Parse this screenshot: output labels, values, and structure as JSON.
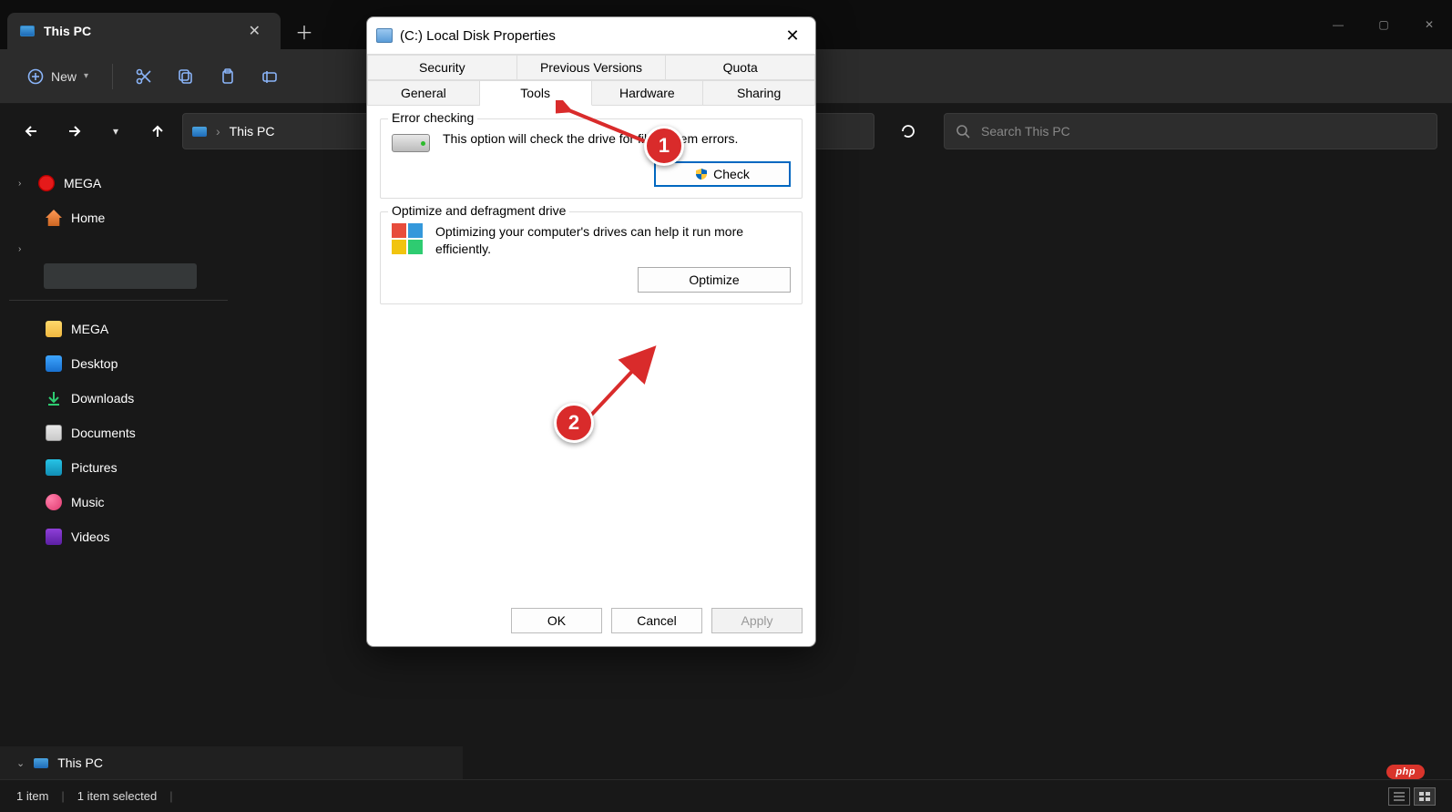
{
  "window": {
    "tab_title": "This PC",
    "newtab_tooltip": "New tab",
    "controls": {
      "min": "—",
      "max": "▢",
      "close": "✕"
    }
  },
  "toolbar": {
    "new_label": "New"
  },
  "nav": {
    "address_label": "This PC",
    "search_placeholder": "Search This PC"
  },
  "sidebar": {
    "mega": "MEGA",
    "home": "Home",
    "mega_folder": "MEGA",
    "desktop": "Desktop",
    "downloads": "Downloads",
    "documents": "Documents",
    "pictures": "Pictures",
    "music": "Music",
    "videos": "Videos",
    "this_pc": "This PC"
  },
  "statusbar": {
    "items": "1 item",
    "selected": "1 item selected"
  },
  "dialog": {
    "title": "(C:) Local Disk Properties",
    "tabs_row1": [
      "Security",
      "Previous Versions",
      "Quota"
    ],
    "tabs_row2": [
      "General",
      "Tools",
      "Hardware",
      "Sharing"
    ],
    "active_tab": "Tools",
    "error_checking": {
      "legend": "Error checking",
      "text": "This option will check the drive for file system errors.",
      "button": "Check"
    },
    "optimize": {
      "legend": "Optimize and defragment drive",
      "text": "Optimizing your computer's drives can help it run more efficiently.",
      "button": "Optimize"
    },
    "footer": {
      "ok": "OK",
      "cancel": "Cancel",
      "apply": "Apply"
    }
  },
  "annotations": {
    "badge1": "1",
    "badge2": "2"
  },
  "watermark": "php"
}
